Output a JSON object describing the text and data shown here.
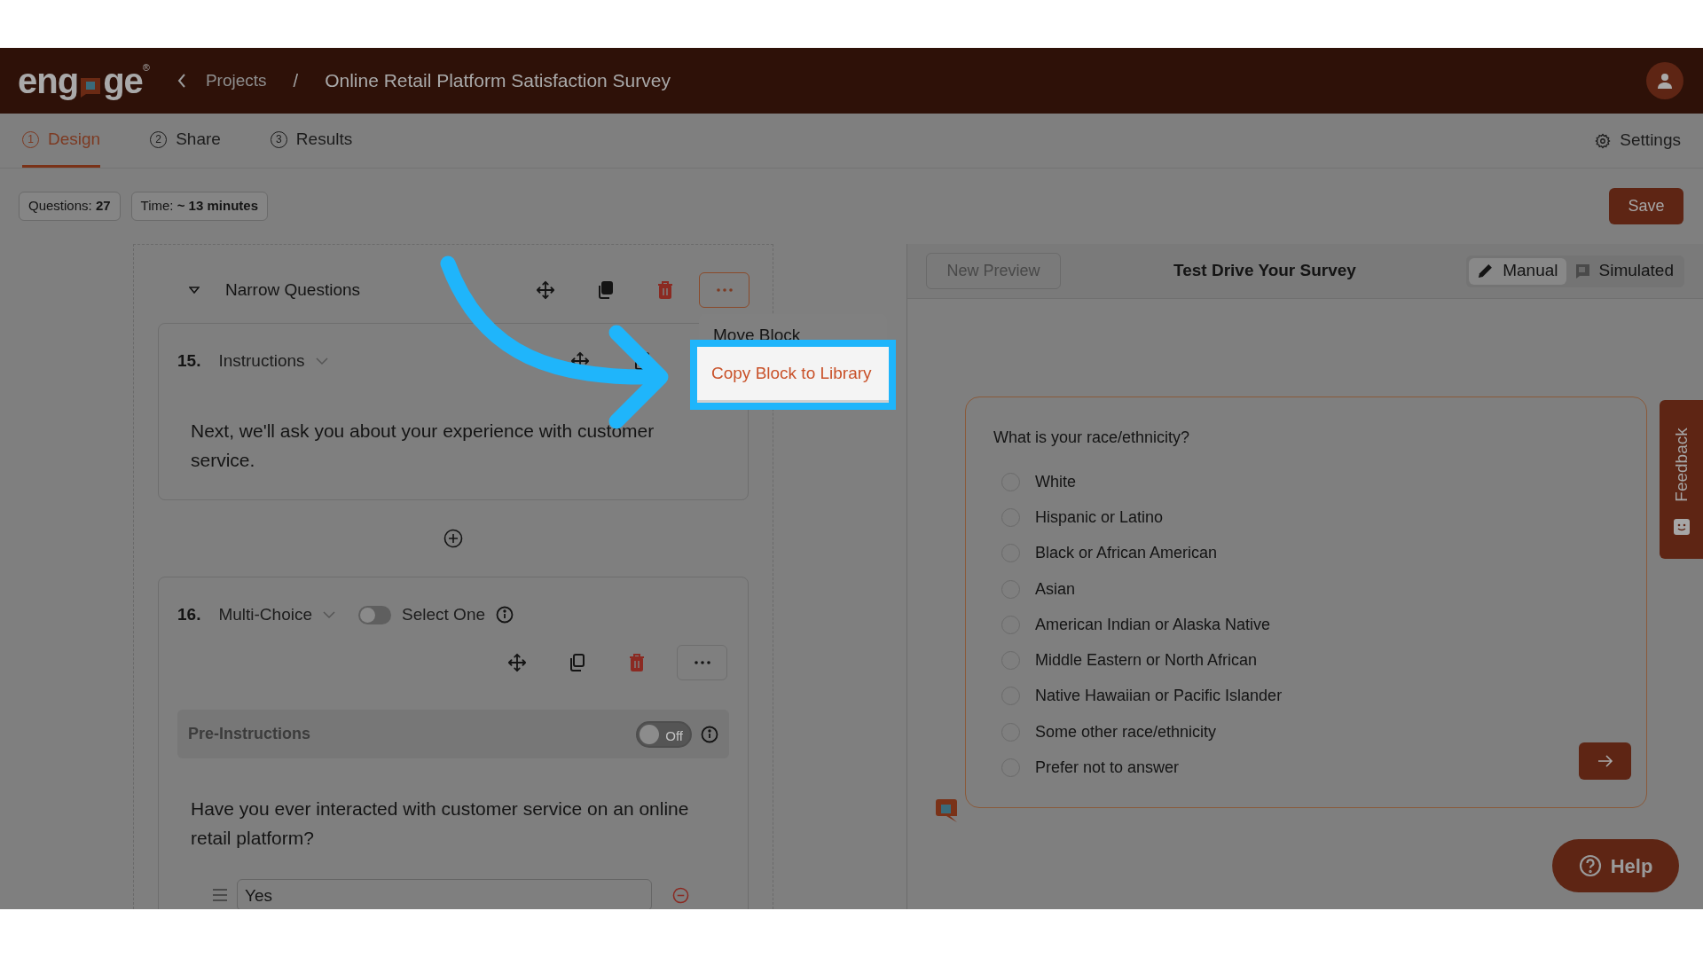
{
  "header": {
    "logo": {
      "start": "eng",
      "end": "ge",
      "mark": "®"
    },
    "breadcrumb": "Projects",
    "separator": "/",
    "title": "Online Retail Platform Satisfaction Survey"
  },
  "tabs": [
    {
      "number": "1",
      "label": "Design",
      "selected": true
    },
    {
      "number": "2",
      "label": "Share",
      "selected": false
    },
    {
      "number": "3",
      "label": "Results",
      "selected": false
    }
  ],
  "settings": "Settings",
  "badges": [
    "Questions: **27**",
    "Time: **~ 13 minutes**"
  ],
  "save": "Save",
  "block": {
    "title": "Narrow Questions"
  },
  "menu": [
    {
      "label": "Move Block",
      "highlighted": false
    },
    {
      "label": "Copy Block to Library",
      "highlighted": true
    }
  ],
  "questions": [
    {
      "kind": "instructions",
      "number": "15.",
      "type": "Instructions",
      "text": "Next, we'll ask you about your experience with customer service."
    },
    {
      "kind": "multi_choice",
      "number": "16.",
      "type": "Multi-Choice",
      "toggle": {
        "label": "Select One",
        "on": false
      },
      "pre_instructions": {
        "label": "Pre-Instructions",
        "on": false,
        "state_text": "Off"
      },
      "text": "Have you ever interacted with customer service on an online retail platform?",
      "options": [
        "Yes"
      ]
    }
  ],
  "preview": {
    "new_preview": "New Preview",
    "title": "Test Drive Your Survey",
    "modes": [
      {
        "kind": "pencil",
        "label": "Manual",
        "selected": true
      },
      {
        "kind": "chat",
        "label": "Simulated",
        "selected": false
      }
    ],
    "question": "What is your race/ethnicity?",
    "options": [
      {
        "label": "White",
        "selected": false
      },
      {
        "label": "Hispanic or Latino",
        "selected": false
      },
      {
        "label": "Black or African American",
        "selected": false
      },
      {
        "label": "Asian",
        "selected": false
      },
      {
        "label": "American Indian or Alaska Native",
        "selected": false
      },
      {
        "label": "Middle Eastern or North African",
        "selected": false
      },
      {
        "label": "Native Hawaiian or Pacific Islander",
        "selected": false
      },
      {
        "label": "Some other race/ethnicity",
        "selected": false
      },
      {
        "label": "Prefer not to answer",
        "selected": false
      }
    ]
  },
  "feedback": "Feedback",
  "help": "Help"
}
